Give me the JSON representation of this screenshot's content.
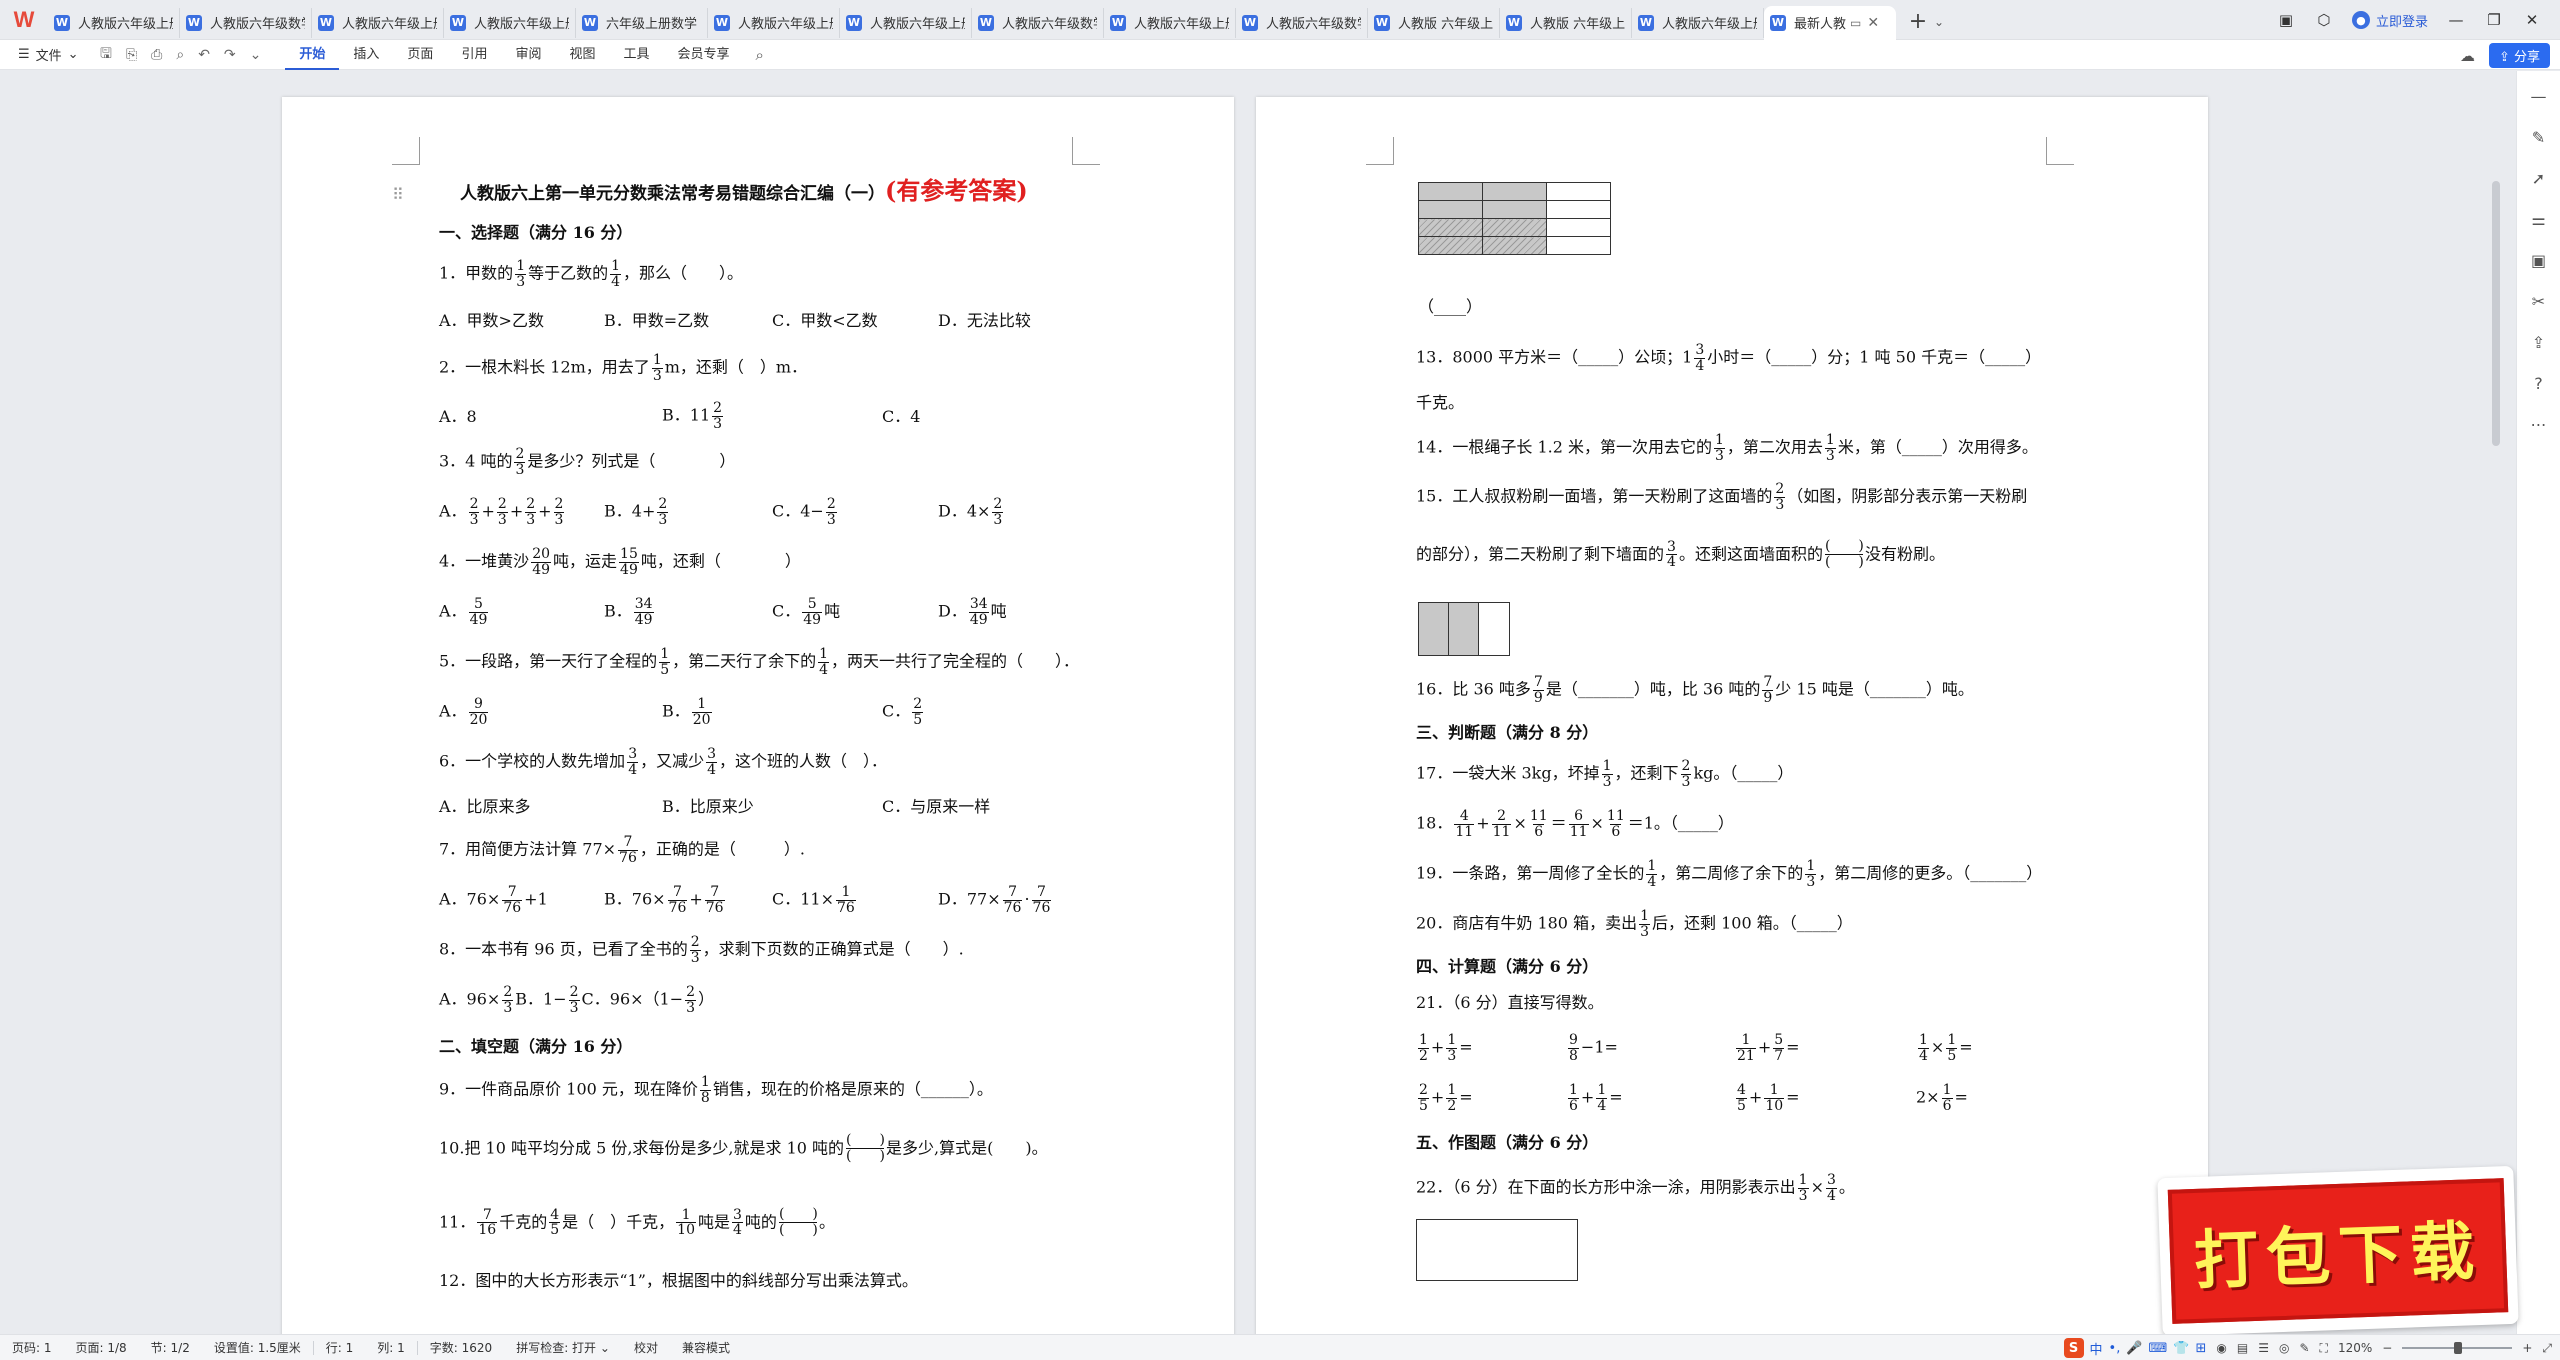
{
  "tabs": {
    "app_logo": "W",
    "items": [
      {
        "label": "人教版六年级上册"
      },
      {
        "label": "人教版六年级数学"
      },
      {
        "label": "人教版六年级上册"
      },
      {
        "label": "人教版六年级上册"
      },
      {
        "label": "六年级上册数学"
      },
      {
        "label": "人教版六年级上册"
      },
      {
        "label": "人教版六年级上册"
      },
      {
        "label": "人教版六年级数学"
      },
      {
        "label": "人教版六年级上册"
      },
      {
        "label": "人教版六年级数学"
      },
      {
        "label": "人教版 六年级上"
      },
      {
        "label": "人教版 六年级上"
      },
      {
        "label": "人教版六年级上册"
      }
    ],
    "active_label": "最新人教",
    "login_label": "立即登录"
  },
  "menubar": {
    "file_label": "文件",
    "tabs": [
      "开始",
      "插入",
      "页面",
      "引用",
      "审阅",
      "视图",
      "工具",
      "会员专享"
    ],
    "active_tab": "开始",
    "share_label": "分享"
  },
  "page1": {
    "title": "人教版六上第一单元分数乘法常考易错题综合汇编（一）",
    "title_red": "(有参考答案)",
    "sec1": "一、选择题（满分 16 分）",
    "q1": {
      "a": "1．甲数的",
      "b": "等于乙数的",
      "c": "，那么（　　）。",
      "f1": [
        "1",
        "3"
      ],
      "f2": [
        "1",
        "4"
      ]
    },
    "q1_opts": [
      "A．甲数>乙数",
      "B．甲数=乙数",
      "C．甲数<乙数",
      "D．无法比较"
    ],
    "q2": {
      "a": "2．一根木料长 12m，用去了",
      "b": "m，还剩（　）m．",
      "f1": [
        "1",
        "3"
      ]
    },
    "q2_opts": {
      "a": "A．8",
      "b": "B．11",
      "bf": [
        "2",
        "3"
      ],
      "c": "C．4"
    },
    "q3": {
      "a": "3．4 吨的",
      "b": "是多少？列式是（　　　　）",
      "f1": [
        "2",
        "3"
      ]
    },
    "q3_opts": {
      "a_pre": "A．",
      "a_plus": "+",
      "b": "B．4+",
      "c": "C．4−",
      "d": "D．4×",
      "f": [
        "2",
        "3"
      ]
    },
    "q4": {
      "a": "4．一堆黄沙",
      "b": "吨，运走",
      "c": "吨，还剩（　　　　）",
      "f1": [
        "20",
        "49"
      ],
      "f2": [
        "15",
        "49"
      ]
    },
    "q4_opts": {
      "a": "A．",
      "af": [
        "5",
        "49"
      ],
      "b": "B．",
      "bf": [
        "34",
        "49"
      ],
      "c": "C．",
      "cf": [
        "5",
        "49"
      ],
      "c_unit": "吨",
      "d": "D．",
      "df": [
        "34",
        "49"
      ],
      "d_unit": "吨"
    },
    "q5": {
      "a": "5．一段路，第一天行了全程的",
      "b": "，第二天行了余下的",
      "c": "，两天一共行了完全程的（　　）．",
      "f1": [
        "1",
        "5"
      ],
      "f2": [
        "1",
        "4"
      ]
    },
    "q5_opts": {
      "a": "A．",
      "af": [
        "9",
        "20"
      ],
      "b": "B．",
      "bf": [
        "1",
        "20"
      ],
      "c": "C．",
      "cf": [
        "2",
        "5"
      ]
    },
    "q6": {
      "a": "6．一个学校的人数先增加",
      "b": "，又减少",
      "c": "，这个班的人数（　）．",
      "f1": [
        "3",
        "4"
      ],
      "f2": [
        "3",
        "4"
      ]
    },
    "q6_opts": [
      "A．比原来多",
      "B．比原来少",
      "C．与原来一样"
    ],
    "q7": {
      "a": "7．用简便方法计算 77×",
      "b": "，正确的是（　　　）.",
      "f1": [
        "7",
        "76"
      ]
    },
    "q7_opts": {
      "a": "A．76×",
      "a2": "+1",
      "b": "B．76×",
      "b2": "+",
      "c": "C．11×",
      "d": "D．77×",
      "d2": "·",
      "f": [
        "7",
        "76"
      ],
      "fc": [
        "1",
        "76"
      ]
    },
    "q8": {
      "a": "8．一本书有 96 页，已看了全书的",
      "b": "，求剩下页数的正确算式是（　　）.",
      "f1": [
        "2",
        "3"
      ]
    },
    "q8_opts": {
      "a": "A．96×",
      "b": "B．1−",
      "c": "C．96×（1−",
      "c2": "）",
      "f": [
        "2",
        "3"
      ]
    },
    "sec2": "二、填空题（满分 16 分）",
    "q9": {
      "a": "9．一件商品原价 100 元，现在降价",
      "b": "销售，现在的价格是原来的（______）。",
      "f1": [
        "1",
        "8"
      ]
    },
    "q10": {
      "a": "10.把 10 吨平均分成 5 份,求每份是多少,就是求 10 吨的",
      "b": "是多少,算式是(　　)。",
      "blank_top": "(　　)",
      "blank_bot": "(　　)"
    },
    "q11": {
      "a": "11．",
      "b": "千克的",
      "c": "是（　）千克，",
      "d": "吨是",
      "e": "吨的",
      "f": "。",
      "f1": [
        "7",
        "16"
      ],
      "f2": [
        "4",
        "5"
      ],
      "f3": [
        "1",
        "10"
      ],
      "f4": [
        "3",
        "4"
      ],
      "blank_top": "(　　)",
      "blank_bot": "(　　)"
    },
    "q12": "12．图中的大长方形表示“1”，根据图中的斜线部分写出乘法算式。"
  },
  "page2": {
    "fig_answer": "（____）",
    "q13": {
      "a": "13．8000 平方米＝（_____）公顷；1",
      "b": "小时＝（_____）分；1 吨 50 千克＝（_____）",
      "c": "千克。",
      "f1": [
        "3",
        "4"
      ]
    },
    "q14": {
      "a": "14．一根绳子长 1.2 米，第一次用去它的",
      "b": "，第二次用去",
      "c": "米，第（_____）次用得多。",
      "f1": [
        "1",
        "3"
      ],
      "f2": [
        "1",
        "3"
      ]
    },
    "q15": {
      "a": "15．工人叔叔粉刷一面墙，第一天粉刷了这面墙的",
      "b": "（如图，阴影部分表示第一天粉刷",
      "c": "的部分），第二天粉刷了剩下墙面的",
      "d": "。还剩这面墙面积的",
      "e": "没有粉刷。",
      "f1": [
        "2",
        "3"
      ],
      "f2": [
        "3",
        "4"
      ],
      "blank_top": "(　　)",
      "blank_bot": "(　　)"
    },
    "q16": {
      "a": "16．比 36 吨多",
      "b": "是（_______）吨，比 36 吨的",
      "c": "少 15 吨是（_______）吨。",
      "f1": [
        "7",
        "9"
      ],
      "f2": [
        "7",
        "9"
      ]
    },
    "sec3": "三、判断题（满分 8 分）",
    "q17": {
      "a": "17．一袋大米 3kg，坏掉",
      "b": "，还剩下",
      "c": "kg。（_____）",
      "f1": [
        "1",
        "3"
      ],
      "f2": [
        "2",
        "3"
      ]
    },
    "q18": {
      "a": "18．",
      "b": "+",
      "c": "×",
      "d": "＝",
      "e": "×",
      "g": "＝1。（_____）",
      "f1": [
        "4",
        "11"
      ],
      "f2": [
        "2",
        "11"
      ],
      "f3": [
        "11",
        "6"
      ],
      "f4": [
        "6",
        "11"
      ],
      "f5": [
        "11",
        "6"
      ]
    },
    "q19": {
      "a": "19．一条路，第一周修了全长的",
      "b": "，第二周修了余下的",
      "c": "，第二周修的更多。（_______）",
      "f1": [
        "1",
        "4"
      ],
      "f2": [
        "1",
        "3"
      ]
    },
    "q20": {
      "a": "20．商店有牛奶 180 箱，卖出",
      "b": "后，还剩 100 箱。（_____）",
      "f1": [
        "1",
        "3"
      ]
    },
    "sec4": "四、计算题（满分 6 分）",
    "q21": "21．（6 分）直接写得数。",
    "calc": [
      {
        "f1": [
          "1",
          "2"
        ],
        "op": "+",
        "f2": [
          "1",
          "3"
        ],
        "eq": "="
      },
      {
        "f1": [
          "9",
          "8"
        ],
        "op": "−1",
        "eq": "="
      },
      {
        "f1": [
          "1",
          "21"
        ],
        "op": "+",
        "f2": [
          "5",
          "7"
        ],
        "eq": "="
      },
      {
        "f1": [
          "1",
          "4"
        ],
        "op": "×",
        "f2": [
          "1",
          "5"
        ],
        "eq": "="
      },
      {
        "f1": [
          "2",
          "5"
        ],
        "op": "+",
        "f2": [
          "1",
          "2"
        ],
        "eq": "="
      },
      {
        "f1": [
          "1",
          "6"
        ],
        "op": "+",
        "f2": [
          "1",
          "4"
        ],
        "eq": "="
      },
      {
        "f1": [
          "4",
          "5"
        ],
        "op": "+",
        "f2": [
          "1",
          "10"
        ],
        "eq": "="
      },
      {
        "pre": "2×",
        "f1": [
          "1",
          "6"
        ],
        "eq": "="
      }
    ],
    "sec5": "五、作图题（满分 6 分）",
    "q22": {
      "a": "22．（6 分）在下面的长方形中涂一涂，用阴影表示出",
      "b": "×",
      "c": "。",
      "f1": [
        "1",
        "3"
      ],
      "f2": [
        "3",
        "4"
      ]
    }
  },
  "status": {
    "page": "页码: 1",
    "pages": "页面: 1/8",
    "section": "节: 1/2",
    "setting": "设置值: 1.5厘米",
    "row": "行: 1",
    "col": "列: 1",
    "words": "字数: 1620",
    "spell": "拼写检查: 打开",
    "proof": "校对",
    "compat": "兼容模式",
    "zoom": "120%",
    "ime_label": "中"
  },
  "banner": {
    "text": "打包下载"
  },
  "colors": {
    "accent": "#2b5cd6",
    "title_red": "#e02020",
    "banner_bg": "#e8211a",
    "banner_text": "#fff45a"
  }
}
